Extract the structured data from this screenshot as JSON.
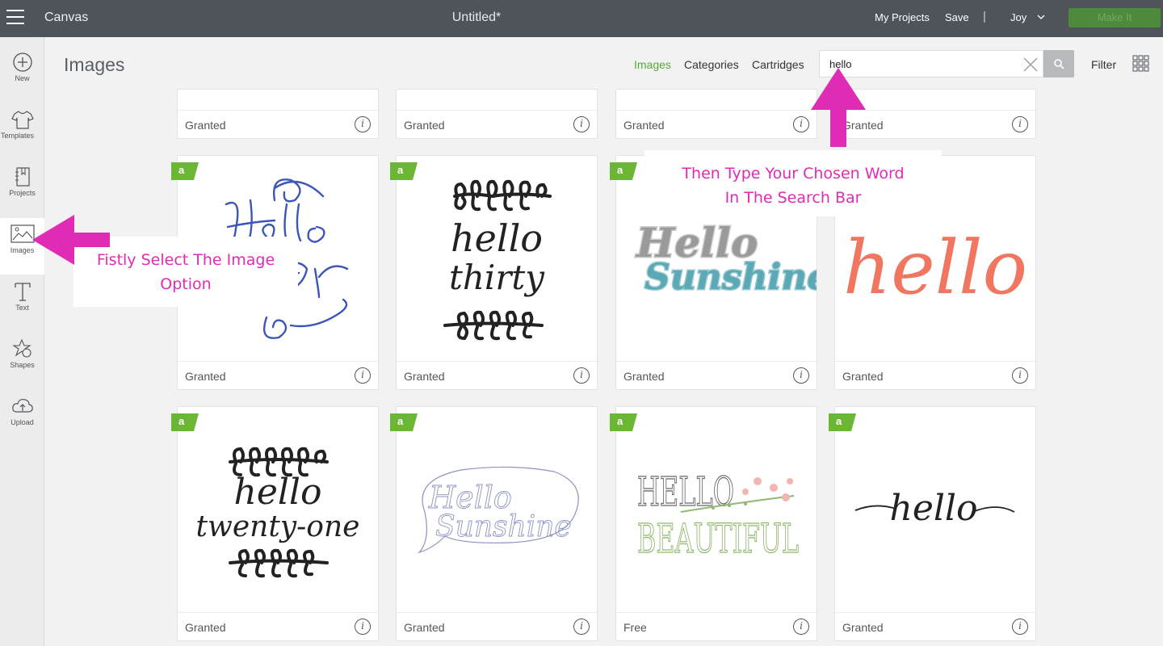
{
  "topbar": {
    "app_title": "Canvas",
    "doc_title": "Untitled*",
    "my_projects": "My Projects",
    "save": "Save",
    "separator": "|",
    "user": "Joy",
    "make_it": "Make It"
  },
  "sidebar": {
    "items": [
      {
        "label": "New",
        "icon": "plus-circle-icon"
      },
      {
        "label": "Templates",
        "icon": "tshirt-icon"
      },
      {
        "label": "Projects",
        "icon": "notebook-icon"
      },
      {
        "label": "Images",
        "icon": "image-icon",
        "active": true
      },
      {
        "label": "Text",
        "icon": "text-icon"
      },
      {
        "label": "Shapes",
        "icon": "shapes-icon"
      },
      {
        "label": "Upload",
        "icon": "cloud-upload-icon"
      }
    ]
  },
  "header": {
    "title": "Images",
    "tabs": [
      {
        "label": "Images",
        "active": true
      },
      {
        "label": "Categories"
      },
      {
        "label": "Cartridges"
      }
    ],
    "search_value": "hello",
    "filter_label": "Filter"
  },
  "grid": {
    "top_row_status": [
      "Granted",
      "Granted",
      "Granted",
      "Granted"
    ],
    "cards": [
      {
        "status": "Granted",
        "badge": "a",
        "art_text": [
          "Hello",
          "ter"
        ]
      },
      {
        "status": "Granted",
        "badge": "a",
        "art_text": [
          "hello",
          "thirty"
        ]
      },
      {
        "status": "Granted",
        "badge": "a",
        "art_text": [
          "Hello",
          "Sunshine"
        ]
      },
      {
        "status": "Granted",
        "badge": "",
        "art_text": [
          "hello"
        ]
      },
      {
        "status": "Granted",
        "badge": "a",
        "art_text": [
          "hello",
          "twenty-one"
        ]
      },
      {
        "status": "Granted",
        "badge": "a",
        "art_text": [
          "Hello",
          "Sunshine"
        ]
      },
      {
        "status": "Free",
        "badge": "a",
        "art_text": [
          "HELLO",
          "BEAUTIFUL"
        ]
      },
      {
        "status": "Granted",
        "badge": "a",
        "art_text": [
          "hello"
        ]
      }
    ]
  },
  "annotations": {
    "left_line1": "Fistly Select The Image",
    "left_line2": "Option",
    "right_line1": "Then Type Your Chosen Word",
    "right_line2": "In The Search Bar"
  },
  "colors": {
    "topbar": "#4e5459",
    "accent_green": "#57a83a",
    "annotation_pink": "#e02bb5"
  }
}
